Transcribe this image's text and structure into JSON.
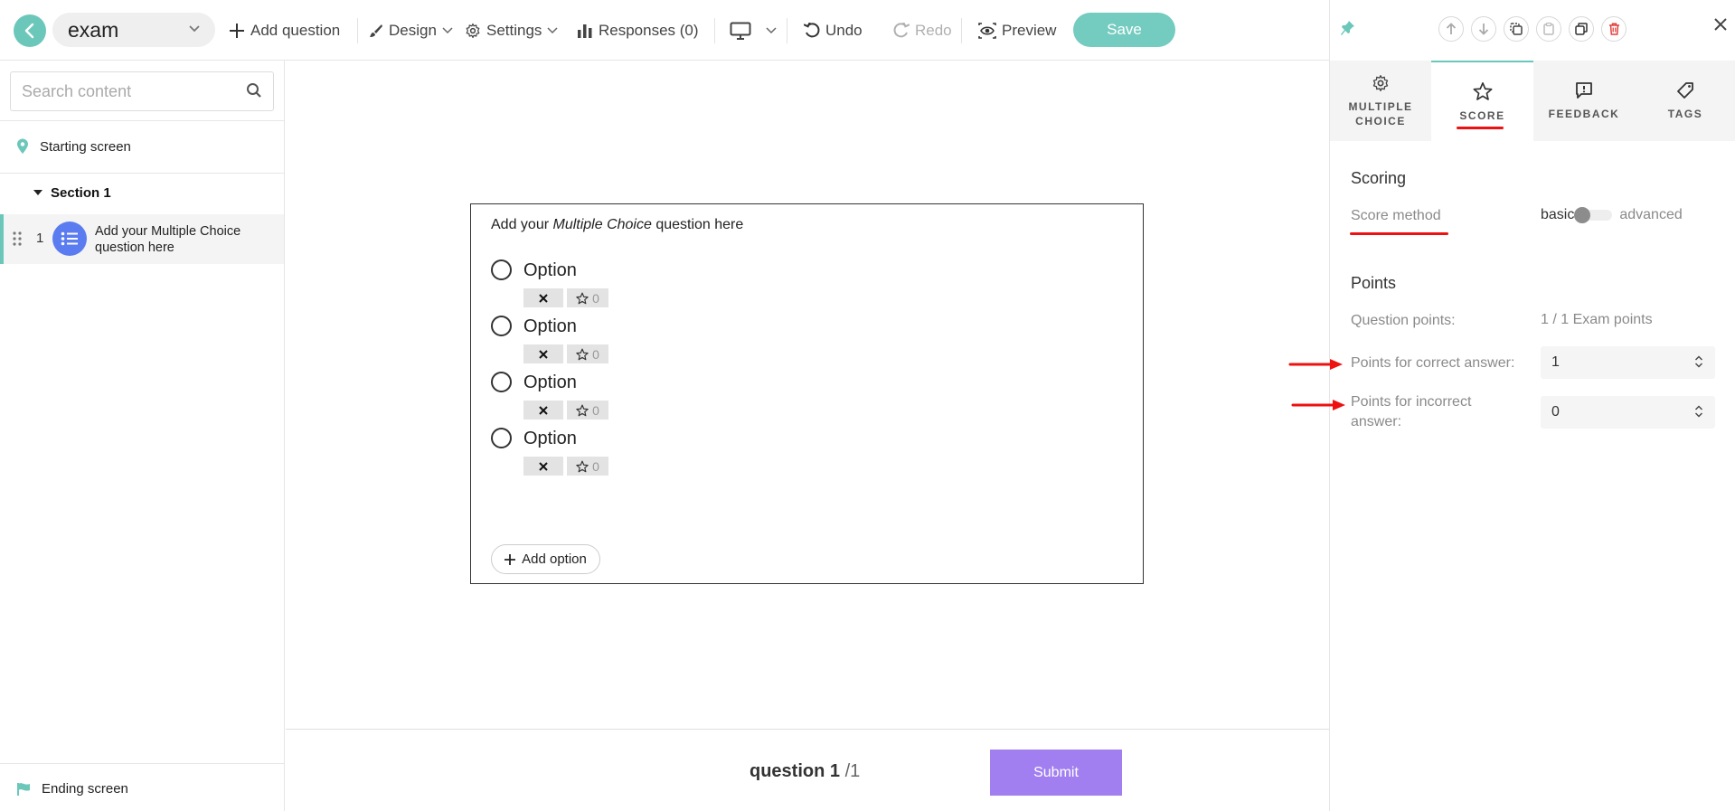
{
  "header": {
    "title": "exam",
    "add_question": "Add question",
    "design": "Design",
    "settings": "Settings",
    "responses": "Responses (0)",
    "undo": "Undo",
    "redo": "Redo",
    "preview": "Preview",
    "save": "Save"
  },
  "sidebar": {
    "search_placeholder": "Search content",
    "starting_screen": "Starting screen",
    "section": "Section 1",
    "question_number": "1",
    "question_text": "Add your Multiple Choice question here",
    "ending_screen": "Ending screen"
  },
  "question": {
    "title_prefix": "Add your ",
    "title_em": "Multiple Choice",
    "title_suffix": " question here",
    "options": [
      {
        "label": "Option",
        "score": "0"
      },
      {
        "label": "Option",
        "score": "0"
      },
      {
        "label": "Option",
        "score": "0"
      },
      {
        "label": "Option",
        "score": "0"
      }
    ],
    "add_option": "Add option"
  },
  "footer": {
    "question_word": "question",
    "current": "1",
    "total": "/1",
    "submit": "Submit"
  },
  "panel": {
    "tabs": [
      {
        "label": "MULTIPLE\nCHOICE",
        "icon": "gear-icon",
        "active": false
      },
      {
        "label": "SCORE",
        "icon": "star-icon",
        "active": true
      },
      {
        "label": "FEEDBACK",
        "icon": "feedback-icon",
        "active": false
      },
      {
        "label": "TAGS",
        "icon": "tag-icon",
        "active": false
      }
    ],
    "scoring_heading": "Scoring",
    "score_method_label": "Score method",
    "score_method_basic": "basic",
    "score_method_advanced": "advanced",
    "points_heading": "Points",
    "question_points_label": "Question points:",
    "question_points_value": "1 / 1 Exam points",
    "correct_label": "Points for correct answer:",
    "correct_value": "1",
    "incorrect_label": "Points for incorrect answer:",
    "incorrect_value": "0"
  },
  "colors": {
    "accent": "#6cc7bb",
    "question_icon": "#5b7cf0",
    "submit": "#a17ff0",
    "delete": "#e0413c",
    "annotation": "#ee1111"
  }
}
